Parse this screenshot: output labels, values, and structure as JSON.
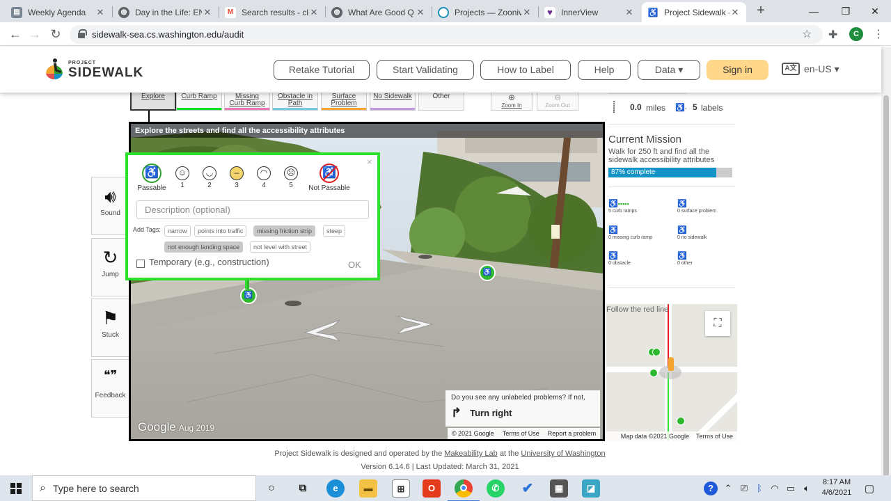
{
  "browser": {
    "tabs": [
      {
        "title": "Weekly Agenda",
        "color": "#7a8694",
        "glyph": "▤"
      },
      {
        "title": "Day in the Life: EN",
        "color": "#5f6368",
        "glyph": "◍"
      },
      {
        "title": "Search results - ck",
        "color": "#ea4335",
        "glyph": "M"
      },
      {
        "title": "What Are Good Q",
        "color": "#5f6368",
        "glyph": "◍"
      },
      {
        "title": "Projects — Zooniv",
        "color": "#1f8fb5",
        "glyph": "⊘"
      },
      {
        "title": "InnerView",
        "color": "#6b2c8f",
        "glyph": "♥"
      },
      {
        "title": "Project Sidewalk -",
        "color": "#333333",
        "glyph": "♿"
      }
    ],
    "url": "sidewalk-sea.cs.washington.edu/audit",
    "profile_initial": "C"
  },
  "header": {
    "logo_small": "PROJECT",
    "logo_big": "SIDEWALK",
    "nav": [
      "Retake Tutorial",
      "Start Validating",
      "How to Label",
      "Help",
      "Data ▾"
    ],
    "signin": "Sign in",
    "language": "en-US ▾",
    "lang_glyph": "A文"
  },
  "tool_modes": {
    "explore": "Explore",
    "curb_ramp": "Curb Ramp",
    "missing_curb_ramp_1": "Missing",
    "missing_curb_ramp_2": "Curb Ramp",
    "obstacle_1": "Obstacle in",
    "obstacle_2": "Path",
    "surface_1": "Surface",
    "surface_2": "Problem",
    "no_sidewalk": "No Sidewalk",
    "other": "Other",
    "zoom_in": "Zoom In",
    "zoom_out": "Zoom Out"
  },
  "mode_colors": {
    "curb_ramp": "#00de26",
    "missing_curb_ramp": "#e679b6",
    "obstacle": "#78c8e0",
    "surface": "#f4a531",
    "no_sidewalk": "#bf97db"
  },
  "side_buttons": {
    "sound": "Sound",
    "jump": "Jump",
    "stuck": "Stuck",
    "feedback": "Feedback"
  },
  "pano": {
    "title": "Explore the streets and find all the accessibility attributes",
    "google": "Google",
    "date": "Aug 2019",
    "attribution": [
      "© 2021 Google",
      "Terms of Use",
      "Report a problem"
    ],
    "hint": "Do you see any unlabeled problems? If not,",
    "turn": "Turn right"
  },
  "context_menu": {
    "passable": "Passable",
    "not_passable": "Not Passable",
    "severities": [
      "1",
      "2",
      "3",
      "4",
      "5"
    ],
    "selected_severity": 3,
    "description_placeholder": "Description (optional)",
    "add_tags": "Add Tags:",
    "tags": [
      {
        "label": "narrow",
        "selected": false
      },
      {
        "label": "points into traffic",
        "selected": false
      },
      {
        "label": "missing friction strip",
        "selected": true
      },
      {
        "label": "steep",
        "selected": false
      },
      {
        "label": "not enough landing space",
        "selected": true
      },
      {
        "label": "not level with street",
        "selected": false
      }
    ],
    "temporary": "Temporary (e.g., construction)",
    "ok": "OK",
    "close": "×"
  },
  "status": {
    "distance": "0.0",
    "distance_unit": "miles",
    "labels": "5",
    "labels_unit": "labels",
    "mission_title": "Current Mission",
    "mission_desc": "Walk for 250 ft and find all the sidewalk accessibility attributes",
    "progress_text": "87% complete",
    "progress_value": 0.87,
    "counts": [
      {
        "label": "5 curb ramps",
        "icon": "♿⸝"
      },
      {
        "label": "0 surface problem",
        "icon": "♿⸏"
      },
      {
        "label": "0 missing curb ramp",
        "icon": "♿⸜"
      },
      {
        "label": "0 no sidewalk",
        "icon": "♿⛔"
      },
      {
        "label": "0 obstacle",
        "icon": "♿▮"
      },
      {
        "label": "0 other",
        "icon": "♿?"
      }
    ]
  },
  "minimap": {
    "follow": "Follow the red line",
    "attribution": [
      "Map data ©2021 Google",
      "Terms of Use"
    ]
  },
  "footer": {
    "text_pre": "Project Sidewalk is designed and operated by the",
    "lab": "Makeability Lab",
    "text_mid": "at the",
    "university": "University of Washington",
    "version": "Version 6.14.6 | Last Updated: March 31, 2021"
  },
  "taskbar": {
    "search_placeholder": "Type here to search",
    "time": "8:17 AM",
    "date": "4/6/2021"
  }
}
